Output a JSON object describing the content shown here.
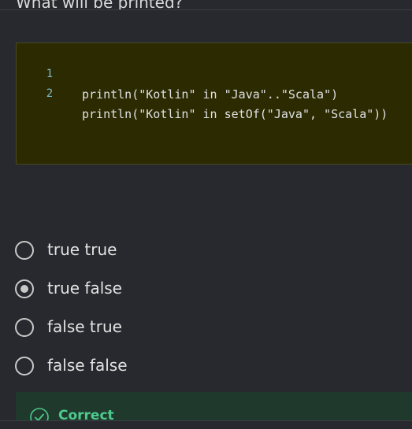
{
  "question": {
    "text": "What will be printed?"
  },
  "code": {
    "lines": [
      {
        "number": "1",
        "text": "println(\"Kotlin\" in \"Java\"..\"Scala\")"
      },
      {
        "number": "2",
        "text": "println(\"Kotlin\" in setOf(\"Java\", \"Scala\"))"
      }
    ]
  },
  "options": [
    {
      "label": "true true",
      "selected": false
    },
    {
      "label": "true false",
      "selected": true
    },
    {
      "label": "false true",
      "selected": false
    },
    {
      "label": "false false",
      "selected": false
    }
  ],
  "feedback": {
    "status": "Correct",
    "icon": "check-circle-icon",
    "color": "#4ec98d"
  }
}
